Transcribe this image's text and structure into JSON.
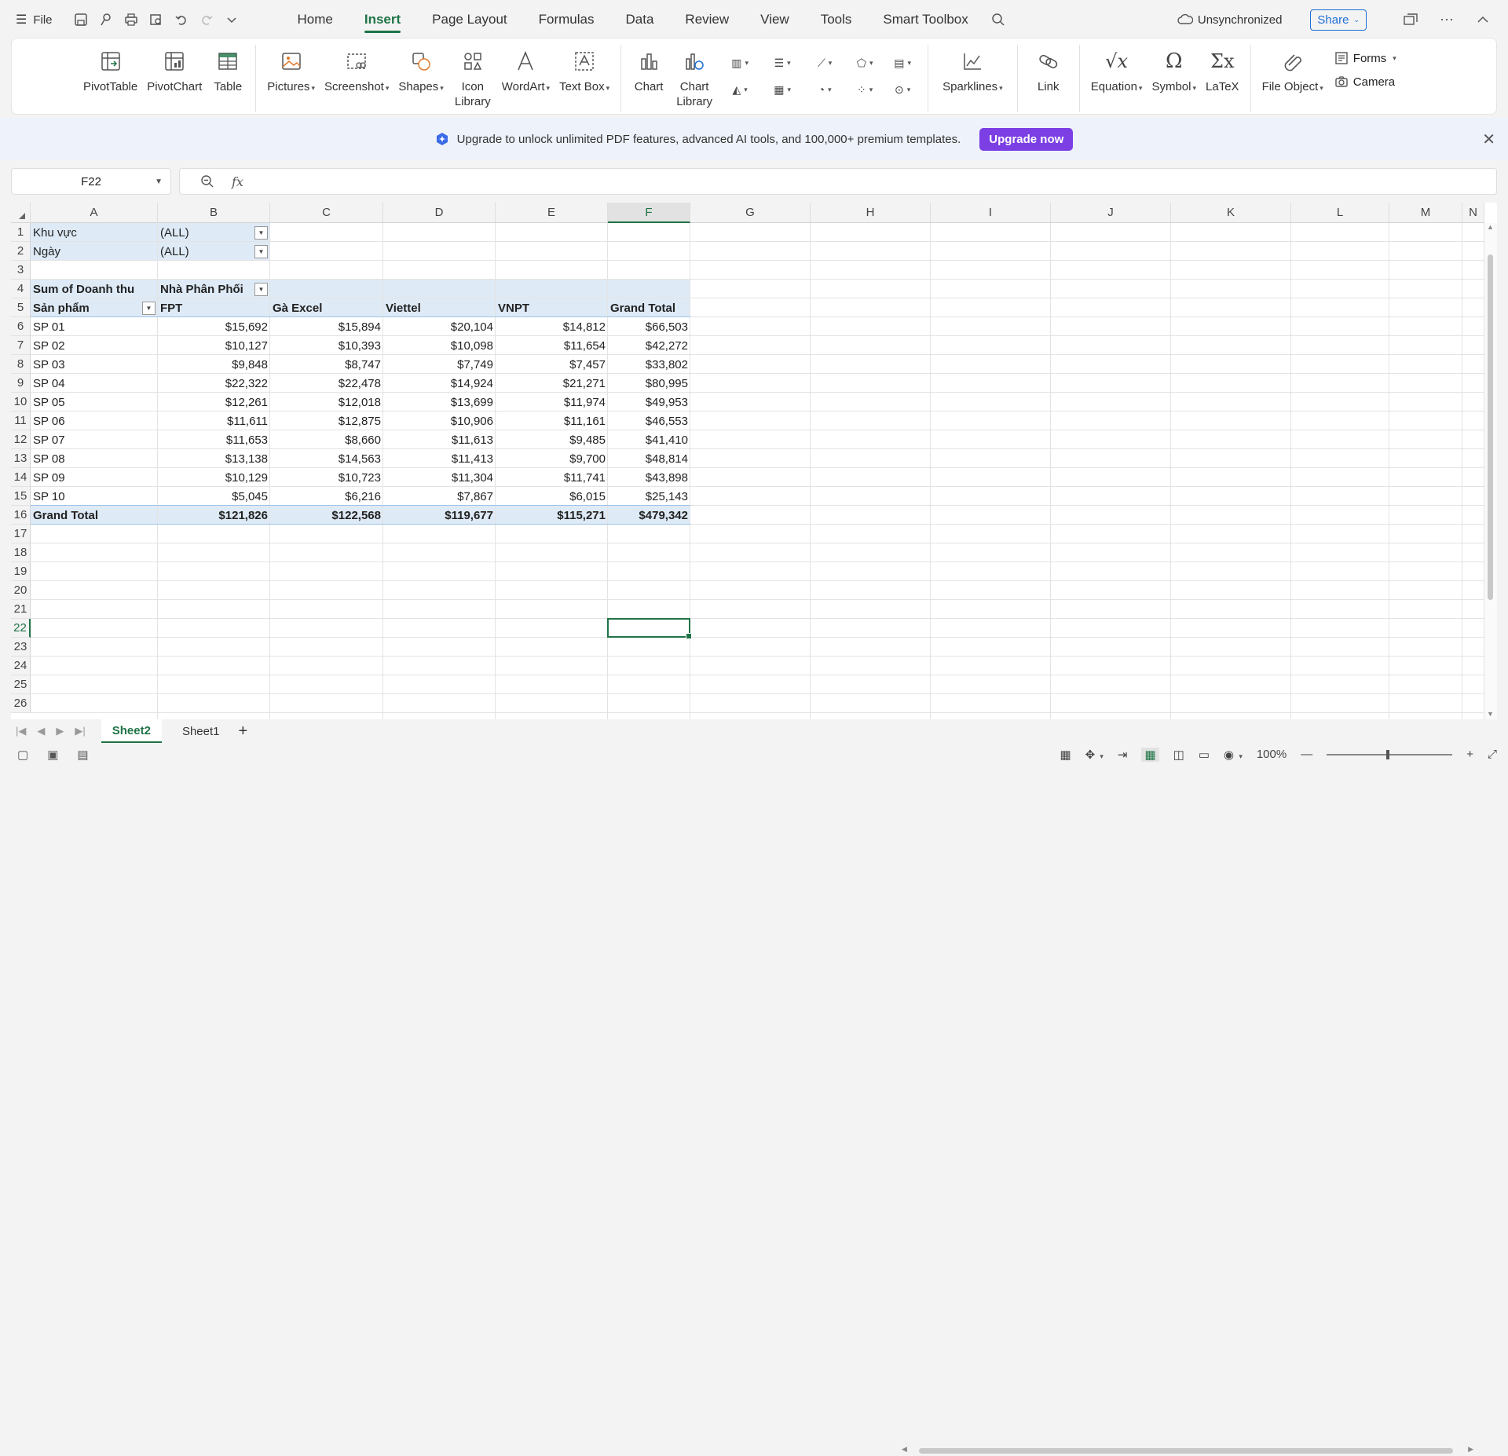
{
  "menubar": {
    "file_label": "File",
    "tabs": [
      "Home",
      "Insert",
      "Page Layout",
      "Formulas",
      "Data",
      "Review",
      "View",
      "Tools",
      "Smart Toolbox"
    ],
    "active_tab": "Insert",
    "sync_status": "Unsynchronized",
    "share_label": "Share"
  },
  "ribbon": {
    "pivottable": "PivotTable",
    "pivotchart": "PivotChart",
    "table": "Table",
    "pictures": "Pictures",
    "screenshot": "Screenshot",
    "shapes": "Shapes",
    "icon_library": "Icon Library",
    "wordart": "WordArt",
    "textbox": "Text Box",
    "chart": "Chart",
    "chart_library": "Chart Library",
    "sparklines": "Sparklines",
    "link": "Link",
    "equation": "Equation",
    "symbol": "Symbol",
    "latex": "LaTeX",
    "file_object": "File Object",
    "forms": "Forms",
    "camera": "Camera"
  },
  "banner": {
    "message": "Upgrade to unlock unlimited PDF features, advanced AI tools, and 100,000+ premium templates.",
    "button": "Upgrade now"
  },
  "formula_bar": {
    "name_box": "F22",
    "fx": "fx",
    "value": ""
  },
  "columns": [
    "A",
    "B",
    "C",
    "D",
    "E",
    "F",
    "G",
    "H",
    "I",
    "J",
    "K",
    "L",
    "M",
    "N"
  ],
  "rows": [
    "1",
    "2",
    "3",
    "4",
    "5",
    "6",
    "7",
    "8",
    "9",
    "10",
    "11",
    "12",
    "13",
    "14",
    "15",
    "16",
    "17",
    "18",
    "19",
    "20",
    "21",
    "22",
    "23",
    "24",
    "25",
    "26"
  ],
  "pivot": {
    "filters": [
      {
        "label": "Khu vực",
        "value": "(ALL)"
      },
      {
        "label": "Ngày",
        "value": "(ALL)"
      }
    ],
    "data_label": "Sum of Doanh thu",
    "col_field": "Nhà Phân Phối",
    "row_field": "Sản phẩm",
    "col_headers": [
      "FPT",
      "Gà Excel",
      "Viettel",
      "VNPT",
      "Grand Total"
    ],
    "rows": [
      {
        "label": "SP 01",
        "values": [
          "$15,692",
          "$15,894",
          "$20,104",
          "$14,812",
          "$66,503"
        ]
      },
      {
        "label": "SP 02",
        "values": [
          "$10,127",
          "$10,393",
          "$10,098",
          "$11,654",
          "$42,272"
        ]
      },
      {
        "label": "SP 03",
        "values": [
          "$9,848",
          "$8,747",
          "$7,749",
          "$7,457",
          "$33,802"
        ]
      },
      {
        "label": "SP 04",
        "values": [
          "$22,322",
          "$22,478",
          "$14,924",
          "$21,271",
          "$80,995"
        ]
      },
      {
        "label": "SP 05",
        "values": [
          "$12,261",
          "$12,018",
          "$13,699",
          "$11,974",
          "$49,953"
        ]
      },
      {
        "label": "SP 06",
        "values": [
          "$11,611",
          "$12,875",
          "$10,906",
          "$11,161",
          "$46,553"
        ]
      },
      {
        "label": "SP 07",
        "values": [
          "$11,653",
          "$8,660",
          "$11,613",
          "$9,485",
          "$41,410"
        ]
      },
      {
        "label": "SP 08",
        "values": [
          "$13,138",
          "$14,563",
          "$11,413",
          "$9,700",
          "$48,814"
        ]
      },
      {
        "label": "SP 09",
        "values": [
          "$10,129",
          "$10,723",
          "$11,304",
          "$11,741",
          "$43,898"
        ]
      },
      {
        "label": "SP 10",
        "values": [
          "$5,045",
          "$6,216",
          "$7,867",
          "$6,015",
          "$25,143"
        ]
      }
    ],
    "grand_total": {
      "label": "Grand Total",
      "values": [
        "$121,826",
        "$122,568",
        "$119,677",
        "$115,271",
        "$479,342"
      ]
    }
  },
  "sheets": [
    "Sheet2",
    "Sheet1"
  ],
  "active_sheet": "Sheet2",
  "status": {
    "zoom": "100%"
  },
  "colors": {
    "accent": "#1f7346",
    "pivot_bg": "#deeaf6",
    "upgrade": "#7b3fe4",
    "share": "#1d6fd6"
  }
}
